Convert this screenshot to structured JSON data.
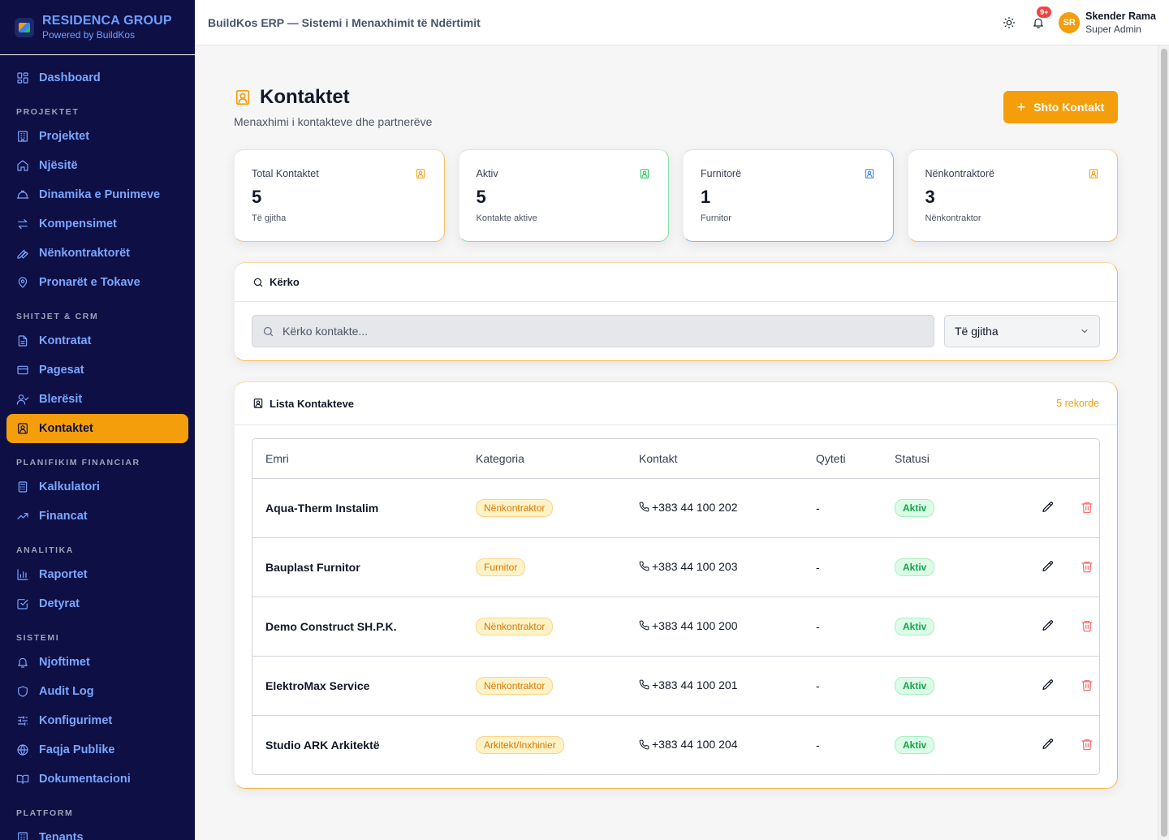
{
  "brand": {
    "name": "RESIDENCA GROUP",
    "sub": "Powered by BuildKos"
  },
  "nav": {
    "dashboard": "Dashboard",
    "sec_projektet": "PROJEKTET",
    "projektet": "Projektet",
    "njesite": "Njësitë",
    "dinamika": "Dinamika e Punimeve",
    "kompensimet": "Kompensimet",
    "nenkontraktoret": "Nënkontraktorët",
    "pronaret": "Pronarët e Tokave",
    "sec_shitjet": "SHITJET & CRM",
    "kontratat": "Kontratat",
    "pagesat": "Pagesat",
    "bleresit": "Blerësit",
    "kontaktet": "Kontaktet",
    "sec_planifikim": "PLANIFIKIM FINANCIAR",
    "kalkulatori": "Kalkulatori",
    "financat": "Financat",
    "sec_analitika": "ANALITIKA",
    "raportet": "Raportet",
    "detyrat": "Detyrat",
    "sec_sistemi": "SISTEMI",
    "njoftimet": "Njoftimet",
    "audit": "Audit Log",
    "konfigurimet": "Konfigurimet",
    "faqja": "Faqja Publike",
    "dokumentacioni": "Dokumentacioni",
    "sec_platform": "PLATFORM",
    "tenants": "Tenants"
  },
  "header": {
    "title": "BuildKos ERP — Sistemi i Menaxhimit të Ndërtimit",
    "notif_badge": "9+",
    "avatar": "SR",
    "user_name": "Skender Rama",
    "user_role": "Super Admin"
  },
  "page": {
    "title": "Kontaktet",
    "subtitle": "Menaxhimi i kontakteve dhe partnerëve",
    "add_button": "Shto Kontakt"
  },
  "stats": [
    {
      "label": "Total Kontaktet",
      "value": "5",
      "hint": "Të gjitha",
      "color": "#f59e0b"
    },
    {
      "label": "Aktiv",
      "value": "5",
      "hint": "Kontakte aktive",
      "color": "#22c55e"
    },
    {
      "label": "Furnitorë",
      "value": "1",
      "hint": "Furnitor",
      "color": "#3b82f6"
    },
    {
      "label": "Nënkontraktorë",
      "value": "3",
      "hint": "Nënkontraktor",
      "color": "#f59e0b"
    }
  ],
  "search": {
    "title": "Kërko",
    "placeholder": "Kërko kontakte...",
    "filter_value": "Të gjitha"
  },
  "list": {
    "title": "Lista Kontakteve",
    "count": "5 rekorde",
    "columns": [
      "Emri",
      "Kategoria",
      "Kontakt",
      "Qyteti",
      "Statusi"
    ],
    "rows": [
      {
        "name": "Aqua-Therm Instalim",
        "category": "Nënkontraktor",
        "phone": "+383 44 100 202",
        "city": "-",
        "status": "Aktiv"
      },
      {
        "name": "Bauplast Furnitor",
        "category": "Furnitor",
        "phone": "+383 44 100 203",
        "city": "-",
        "status": "Aktiv"
      },
      {
        "name": "Demo Construct SH.P.K.",
        "category": "Nënkontraktor",
        "phone": "+383 44 100 200",
        "city": "-",
        "status": "Aktiv"
      },
      {
        "name": "ElektroMax Service",
        "category": "Nënkontraktor",
        "phone": "+383 44 100 201",
        "city": "-",
        "status": "Aktiv"
      },
      {
        "name": "Studio ARK Arkitektë",
        "category": "Arkitekt/Inxhinier",
        "phone": "+383 44 100 204",
        "city": "-",
        "status": "Aktiv"
      }
    ]
  },
  "colors": {
    "accent": "#f59e0b",
    "sidebar_bg": "#0e0f45",
    "nav_text": "#7aa7ff",
    "success": "#16a34a",
    "danger": "#f87171"
  }
}
